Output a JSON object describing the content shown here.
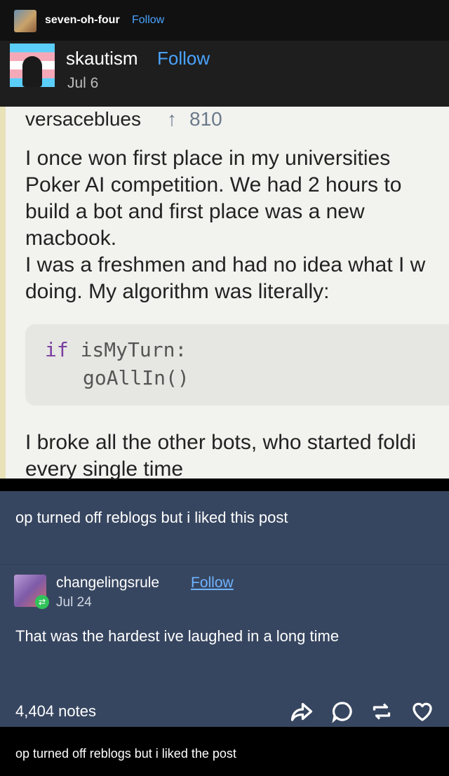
{
  "header": {
    "username": "seven-oh-four",
    "follow_label": "Follow"
  },
  "screenshot": {
    "username": "skautism",
    "follow_label": "Follow",
    "date": "Jul 6",
    "op_username": "versaceblues",
    "upvote_arrow": "↑",
    "votes": "810",
    "lines": [
      "I once won first place in my universities",
      "Poker AI competition. We had 2 hours to",
      "build a bot and first place was a new",
      "macbook.",
      "I was a freshmen and had no idea what I w",
      "doing. My algorithm was literally:"
    ],
    "code_keyword": "if",
    "code_line1_rest": " isMyTurn:",
    "code_line2": "goAllIn()",
    "after_lines": [
      "I broke all the other bots, who started foldi",
      "every single time"
    ]
  },
  "reblog": {
    "text": "op turned off reblogs but i liked this post"
  },
  "comment_user": {
    "username": "changelingsrule",
    "follow_label": "Follow",
    "date": "Jul 24",
    "text": "That was the hardest ive laughed in a long time"
  },
  "footer": {
    "notes": "4,404 notes",
    "icons": [
      "share-icon",
      "reply-icon",
      "reblog-icon",
      "heart-icon"
    ]
  },
  "caption": {
    "text": "op turned off reblogs but i liked the post"
  }
}
